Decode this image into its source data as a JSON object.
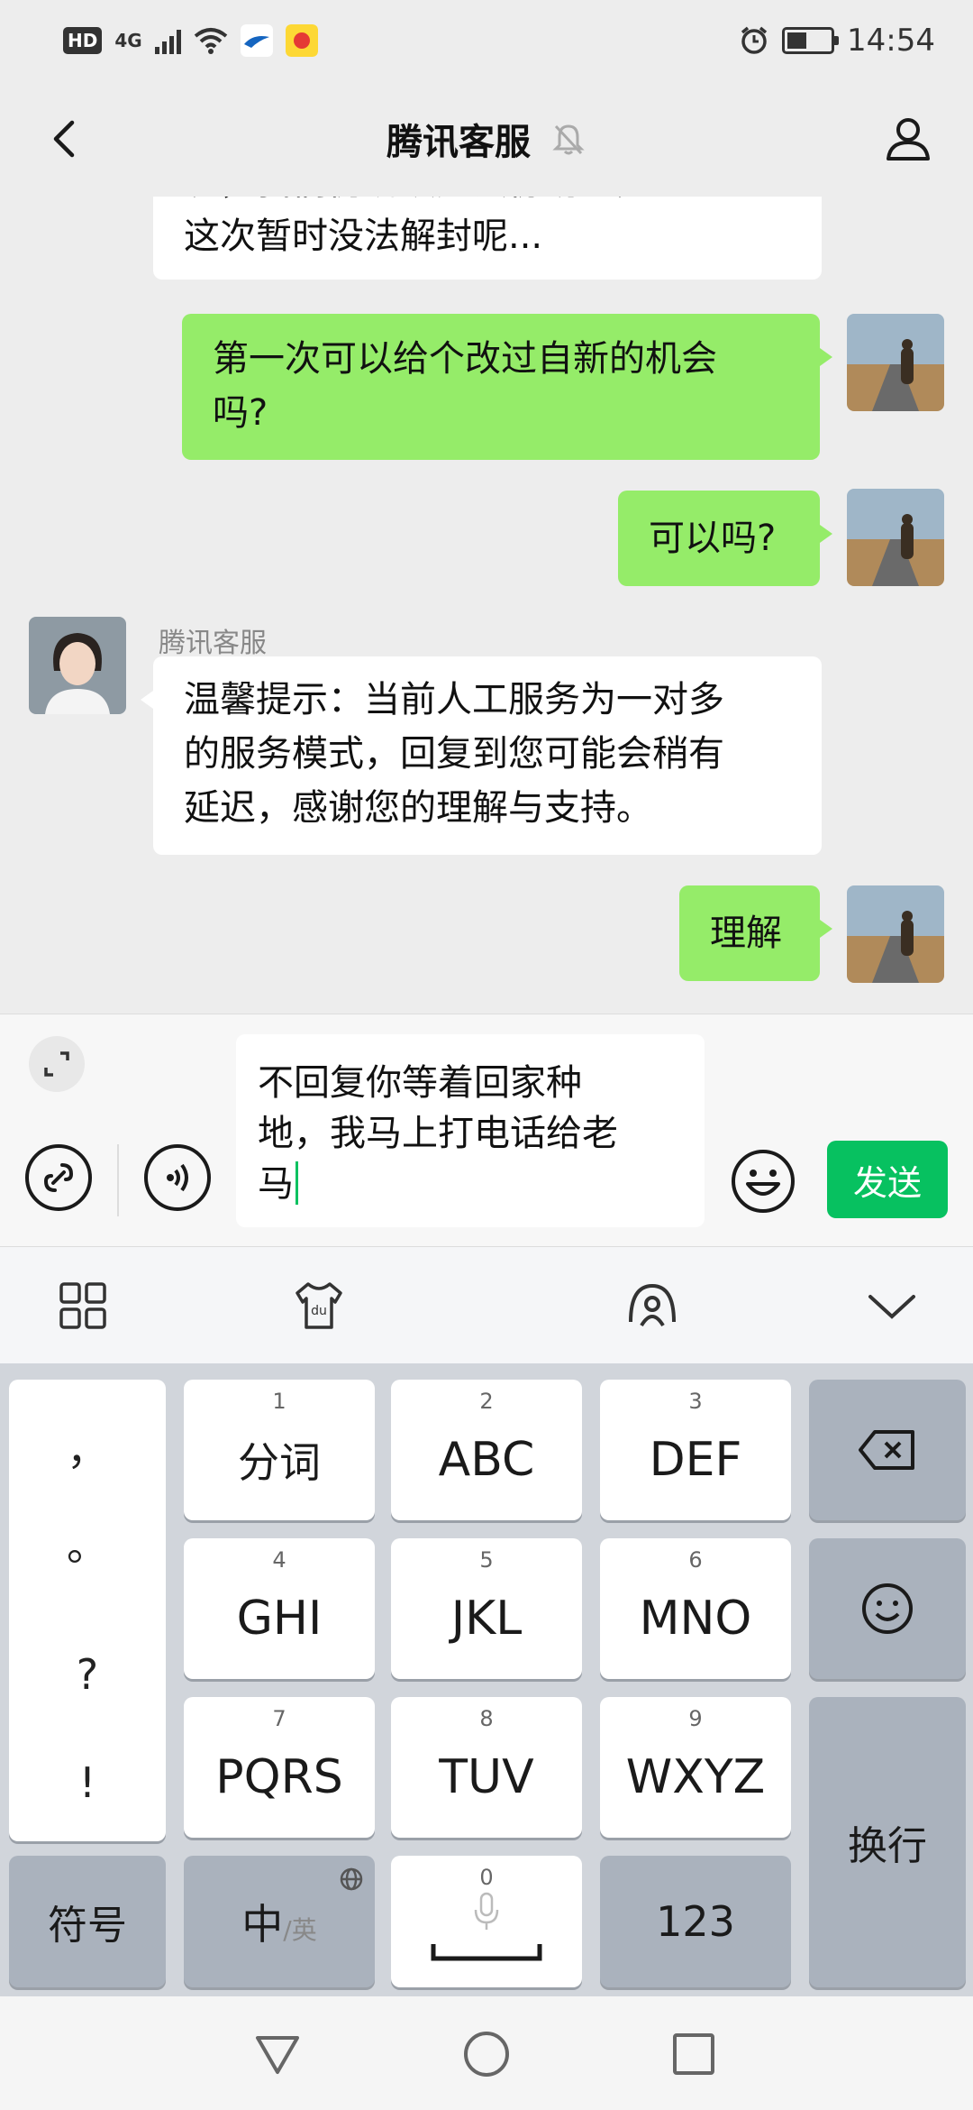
{
  "status_bar": {
    "network_badge": "HD",
    "signal_label": "4G",
    "time": "14:54"
  },
  "header": {
    "title": "腾讯客服"
  },
  "messages": [
    {
      "side": "in",
      "lines": [
        "况，我们仍确认无法协助您处理。",
        "这次暂时没法解封呢..."
      ]
    },
    {
      "side": "out",
      "lines": [
        "第一次可以给个改过自新的机会",
        "吗?"
      ]
    },
    {
      "side": "out",
      "lines": [
        "可以吗?"
      ]
    },
    {
      "side": "in",
      "sender": "腾讯客服",
      "lines": [
        "温馨提示：当前人工服务为一对多",
        "的服务模式，回复到您可能会稍有",
        "延迟，感谢您的理解与支持。"
      ]
    },
    {
      "side": "out",
      "lines": [
        "理解"
      ]
    }
  ],
  "input": {
    "lines": [
      "不回复你等着回家种",
      "地，我马上打电话给老",
      "马"
    ],
    "send_label": "发送"
  },
  "keyboard": {
    "punct": [
      "，",
      "。",
      "?",
      "!"
    ],
    "keys": [
      {
        "num": "1",
        "label": "分词"
      },
      {
        "num": "2",
        "label": "ABC"
      },
      {
        "num": "3",
        "label": "DEF"
      },
      {
        "num": "4",
        "label": "GHI"
      },
      {
        "num": "5",
        "label": "JKL"
      },
      {
        "num": "6",
        "label": "MNO"
      },
      {
        "num": "7",
        "label": "PQRS"
      },
      {
        "num": "8",
        "label": "TUV"
      },
      {
        "num": "9",
        "label": "WXYZ"
      }
    ],
    "symbol_label": "符号",
    "zh_label": "中",
    "en_label": "/英",
    "space_num": "0",
    "num_label": "123",
    "enter_label": "换行"
  },
  "colors": {
    "accent": "#07c160",
    "outgoing_bubble": "#95ec69",
    "incoming_bubble": "#ffffff",
    "background": "#ededed"
  }
}
